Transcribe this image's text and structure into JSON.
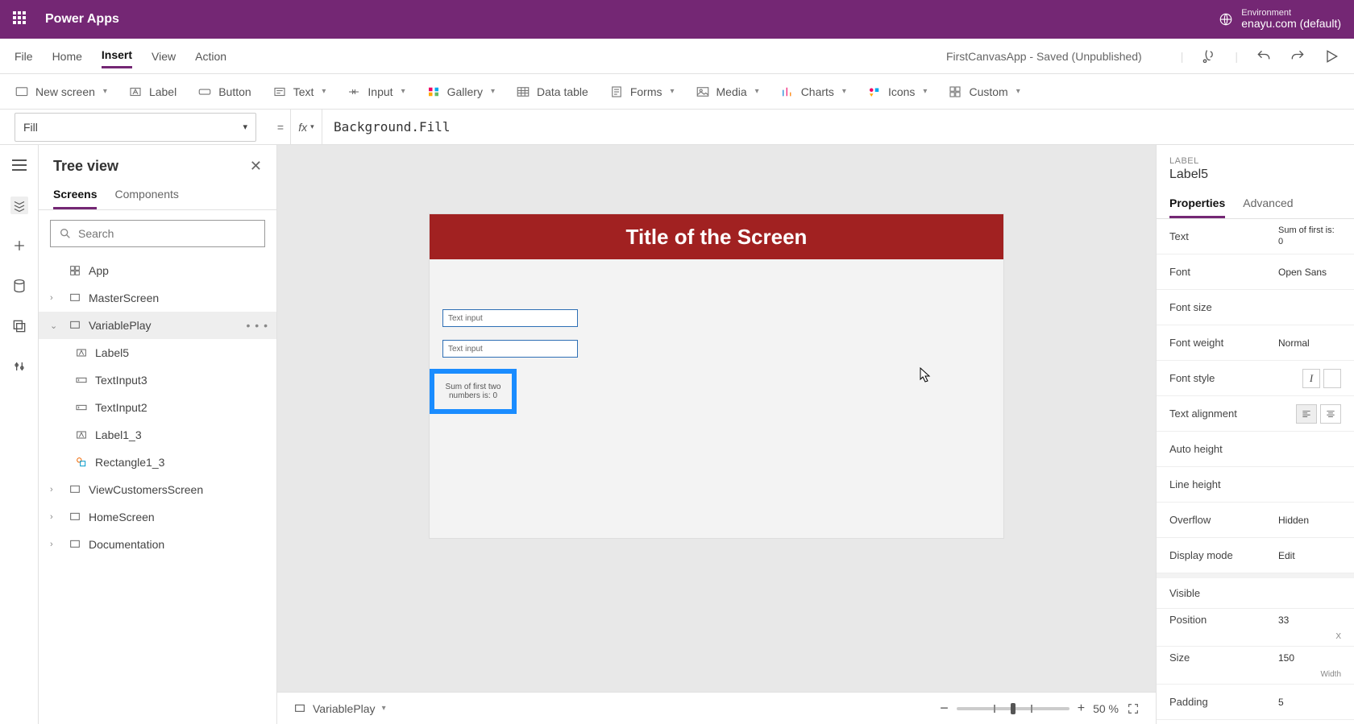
{
  "header": {
    "app_title": "Power Apps",
    "env_label": "Environment",
    "env_value": "enayu.com (default)"
  },
  "menu": {
    "items": [
      "File",
      "Home",
      "Insert",
      "View",
      "Action"
    ],
    "active": "Insert",
    "status": "FirstCanvasApp - Saved (Unpublished)"
  },
  "ribbon": {
    "new_screen": "New screen",
    "label": "Label",
    "button": "Button",
    "text": "Text",
    "input": "Input",
    "gallery": "Gallery",
    "data_table": "Data table",
    "forms": "Forms",
    "media": "Media",
    "charts": "Charts",
    "icons": "Icons",
    "custom": "Custom"
  },
  "formula": {
    "property": "Fill",
    "value": "Background.Fill"
  },
  "tree": {
    "title": "Tree view",
    "tabs": [
      "Screens",
      "Components"
    ],
    "active_tab": "Screens",
    "search_placeholder": "Search",
    "items": [
      {
        "label": "App"
      },
      {
        "label": "MasterScreen"
      },
      {
        "label": "VariablePlay"
      },
      {
        "label": "Label5"
      },
      {
        "label": "TextInput3"
      },
      {
        "label": "TextInput2"
      },
      {
        "label": "Label1_3"
      },
      {
        "label": "Rectangle1_3"
      },
      {
        "label": "ViewCustomersScreen"
      },
      {
        "label": "HomeScreen"
      },
      {
        "label": "Documentation"
      }
    ]
  },
  "canvas": {
    "title": "Title of the Screen",
    "text_input_placeholder": "Text input",
    "selected_label": "Sum of first two numbers is: 0"
  },
  "statusbar": {
    "screen": "VariablePlay",
    "zoom": "50 %"
  },
  "props": {
    "type": "LABEL",
    "name": "Label5",
    "tabs": [
      "Properties",
      "Advanced"
    ],
    "active_tab": "Properties",
    "rows": {
      "text_label": "Text",
      "text_value": "Sum of first is: 0",
      "font_label": "Font",
      "font_value": "Open Sans",
      "fontsize_label": "Font size",
      "fontweight_label": "Font weight",
      "fontweight_value": "Normal",
      "fontstyle_label": "Font style",
      "textalign_label": "Text alignment",
      "autoheight_label": "Auto height",
      "lineheight_label": "Line height",
      "overflow_label": "Overflow",
      "overflow_value": "Hidden",
      "displaymode_label": "Display mode",
      "displaymode_value": "Edit",
      "visible_label": "Visible",
      "position_label": "Position",
      "position_value": "33",
      "position_sub": "X",
      "size_label": "Size",
      "size_value": "150",
      "size_sub": "Width",
      "padding_label": "Padding",
      "padding_value": "5"
    }
  }
}
